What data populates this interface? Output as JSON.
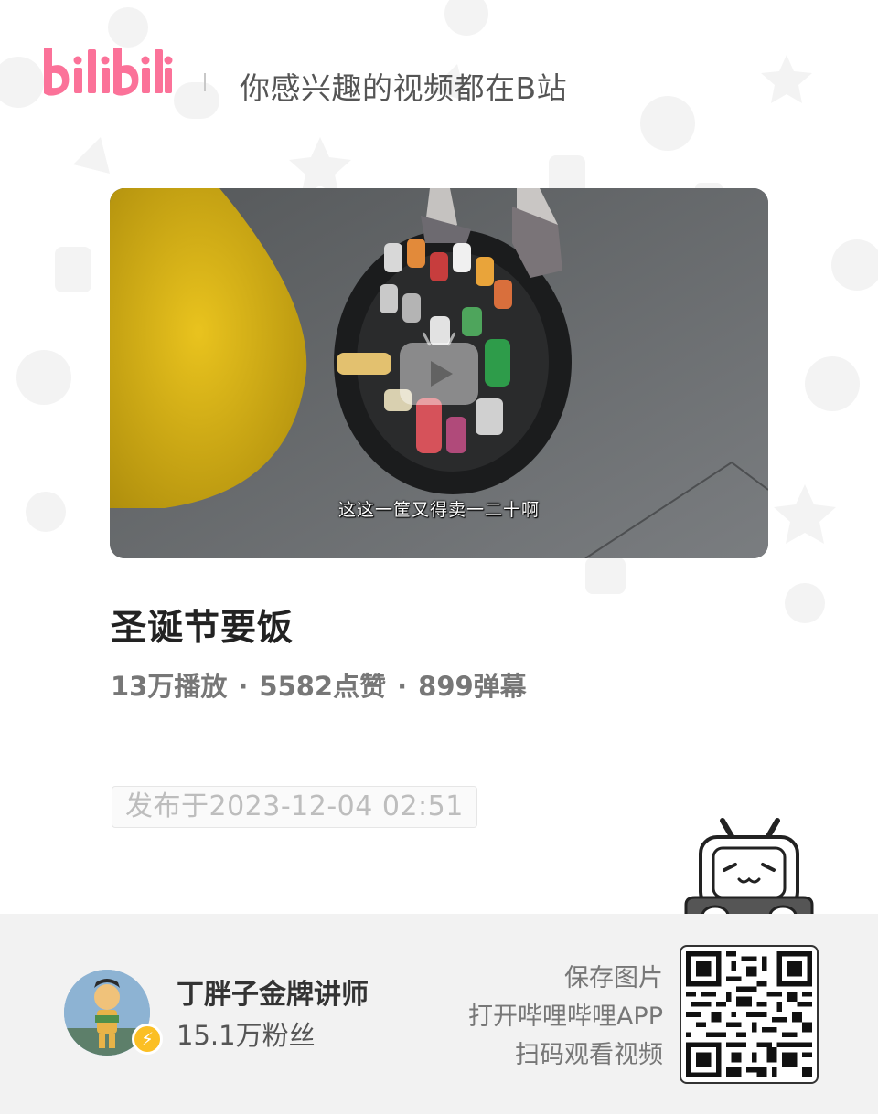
{
  "header": {
    "logo_text": "bilibili",
    "slogan": "你感兴趣的视频都在B站"
  },
  "video": {
    "subtitle": "这这一筐又得卖一二十啊",
    "play_icon": "play-icon"
  },
  "title": "圣诞节要饭",
  "stats": {
    "plays": "13万播放",
    "likes": "5582点赞",
    "danmaku": "899弹幕",
    "separator": "·"
  },
  "published": "发布于2023-12-04 02:51",
  "uploader": {
    "name": "丁胖子金牌讲师",
    "fans": "15.1万粉丝",
    "badge_icon": "lightning-icon"
  },
  "cta": {
    "line1": "保存图片",
    "line2": "打开哔哩哔哩APP",
    "line3": "扫码观看视频"
  },
  "colors": {
    "brand_pink": "#fb7299",
    "footer_bg": "#f2f2f2",
    "badge_yellow": "#fbbf24"
  }
}
